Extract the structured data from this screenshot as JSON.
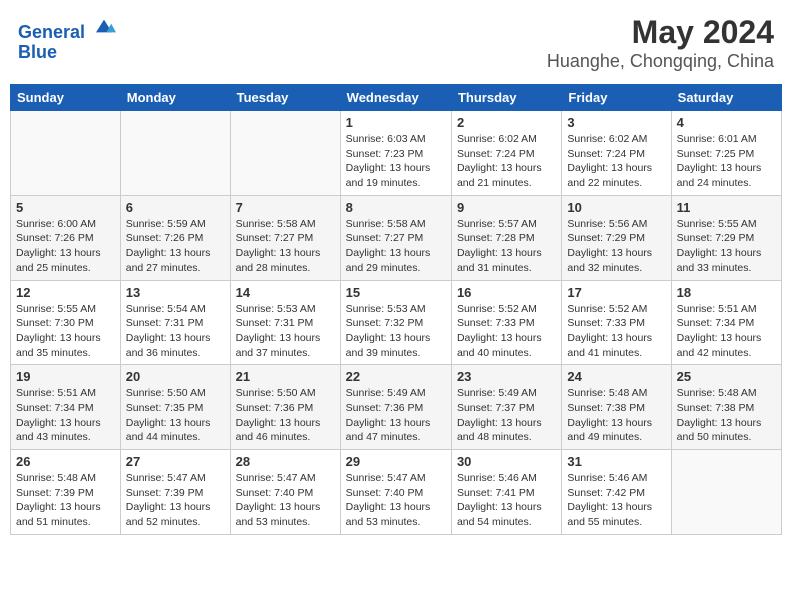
{
  "header": {
    "logo_line1": "General",
    "logo_line2": "Blue",
    "month": "May 2024",
    "location": "Huanghe, Chongqing, China"
  },
  "weekdays": [
    "Sunday",
    "Monday",
    "Tuesday",
    "Wednesday",
    "Thursday",
    "Friday",
    "Saturday"
  ],
  "weeks": [
    [
      {
        "day": "",
        "sunrise": "",
        "sunset": "",
        "daylight": ""
      },
      {
        "day": "",
        "sunrise": "",
        "sunset": "",
        "daylight": ""
      },
      {
        "day": "",
        "sunrise": "",
        "sunset": "",
        "daylight": ""
      },
      {
        "day": "1",
        "sunrise": "Sunrise: 6:03 AM",
        "sunset": "Sunset: 7:23 PM",
        "daylight": "Daylight: 13 hours and 19 minutes."
      },
      {
        "day": "2",
        "sunrise": "Sunrise: 6:02 AM",
        "sunset": "Sunset: 7:24 PM",
        "daylight": "Daylight: 13 hours and 21 minutes."
      },
      {
        "day": "3",
        "sunrise": "Sunrise: 6:02 AM",
        "sunset": "Sunset: 7:24 PM",
        "daylight": "Daylight: 13 hours and 22 minutes."
      },
      {
        "day": "4",
        "sunrise": "Sunrise: 6:01 AM",
        "sunset": "Sunset: 7:25 PM",
        "daylight": "Daylight: 13 hours and 24 minutes."
      }
    ],
    [
      {
        "day": "5",
        "sunrise": "Sunrise: 6:00 AM",
        "sunset": "Sunset: 7:26 PM",
        "daylight": "Daylight: 13 hours and 25 minutes."
      },
      {
        "day": "6",
        "sunrise": "Sunrise: 5:59 AM",
        "sunset": "Sunset: 7:26 PM",
        "daylight": "Daylight: 13 hours and 27 minutes."
      },
      {
        "day": "7",
        "sunrise": "Sunrise: 5:58 AM",
        "sunset": "Sunset: 7:27 PM",
        "daylight": "Daylight: 13 hours and 28 minutes."
      },
      {
        "day": "8",
        "sunrise": "Sunrise: 5:58 AM",
        "sunset": "Sunset: 7:27 PM",
        "daylight": "Daylight: 13 hours and 29 minutes."
      },
      {
        "day": "9",
        "sunrise": "Sunrise: 5:57 AM",
        "sunset": "Sunset: 7:28 PM",
        "daylight": "Daylight: 13 hours and 31 minutes."
      },
      {
        "day": "10",
        "sunrise": "Sunrise: 5:56 AM",
        "sunset": "Sunset: 7:29 PM",
        "daylight": "Daylight: 13 hours and 32 minutes."
      },
      {
        "day": "11",
        "sunrise": "Sunrise: 5:55 AM",
        "sunset": "Sunset: 7:29 PM",
        "daylight": "Daylight: 13 hours and 33 minutes."
      }
    ],
    [
      {
        "day": "12",
        "sunrise": "Sunrise: 5:55 AM",
        "sunset": "Sunset: 7:30 PM",
        "daylight": "Daylight: 13 hours and 35 minutes."
      },
      {
        "day": "13",
        "sunrise": "Sunrise: 5:54 AM",
        "sunset": "Sunset: 7:31 PM",
        "daylight": "Daylight: 13 hours and 36 minutes."
      },
      {
        "day": "14",
        "sunrise": "Sunrise: 5:53 AM",
        "sunset": "Sunset: 7:31 PM",
        "daylight": "Daylight: 13 hours and 37 minutes."
      },
      {
        "day": "15",
        "sunrise": "Sunrise: 5:53 AM",
        "sunset": "Sunset: 7:32 PM",
        "daylight": "Daylight: 13 hours and 39 minutes."
      },
      {
        "day": "16",
        "sunrise": "Sunrise: 5:52 AM",
        "sunset": "Sunset: 7:33 PM",
        "daylight": "Daylight: 13 hours and 40 minutes."
      },
      {
        "day": "17",
        "sunrise": "Sunrise: 5:52 AM",
        "sunset": "Sunset: 7:33 PM",
        "daylight": "Daylight: 13 hours and 41 minutes."
      },
      {
        "day": "18",
        "sunrise": "Sunrise: 5:51 AM",
        "sunset": "Sunset: 7:34 PM",
        "daylight": "Daylight: 13 hours and 42 minutes."
      }
    ],
    [
      {
        "day": "19",
        "sunrise": "Sunrise: 5:51 AM",
        "sunset": "Sunset: 7:34 PM",
        "daylight": "Daylight: 13 hours and 43 minutes."
      },
      {
        "day": "20",
        "sunrise": "Sunrise: 5:50 AM",
        "sunset": "Sunset: 7:35 PM",
        "daylight": "Daylight: 13 hours and 44 minutes."
      },
      {
        "day": "21",
        "sunrise": "Sunrise: 5:50 AM",
        "sunset": "Sunset: 7:36 PM",
        "daylight": "Daylight: 13 hours and 46 minutes."
      },
      {
        "day": "22",
        "sunrise": "Sunrise: 5:49 AM",
        "sunset": "Sunset: 7:36 PM",
        "daylight": "Daylight: 13 hours and 47 minutes."
      },
      {
        "day": "23",
        "sunrise": "Sunrise: 5:49 AM",
        "sunset": "Sunset: 7:37 PM",
        "daylight": "Daylight: 13 hours and 48 minutes."
      },
      {
        "day": "24",
        "sunrise": "Sunrise: 5:48 AM",
        "sunset": "Sunset: 7:38 PM",
        "daylight": "Daylight: 13 hours and 49 minutes."
      },
      {
        "day": "25",
        "sunrise": "Sunrise: 5:48 AM",
        "sunset": "Sunset: 7:38 PM",
        "daylight": "Daylight: 13 hours and 50 minutes."
      }
    ],
    [
      {
        "day": "26",
        "sunrise": "Sunrise: 5:48 AM",
        "sunset": "Sunset: 7:39 PM",
        "daylight": "Daylight: 13 hours and 51 minutes."
      },
      {
        "day": "27",
        "sunrise": "Sunrise: 5:47 AM",
        "sunset": "Sunset: 7:39 PM",
        "daylight": "Daylight: 13 hours and 52 minutes."
      },
      {
        "day": "28",
        "sunrise": "Sunrise: 5:47 AM",
        "sunset": "Sunset: 7:40 PM",
        "daylight": "Daylight: 13 hours and 53 minutes."
      },
      {
        "day": "29",
        "sunrise": "Sunrise: 5:47 AM",
        "sunset": "Sunset: 7:40 PM",
        "daylight": "Daylight: 13 hours and 53 minutes."
      },
      {
        "day": "30",
        "sunrise": "Sunrise: 5:46 AM",
        "sunset": "Sunset: 7:41 PM",
        "daylight": "Daylight: 13 hours and 54 minutes."
      },
      {
        "day": "31",
        "sunrise": "Sunrise: 5:46 AM",
        "sunset": "Sunset: 7:42 PM",
        "daylight": "Daylight: 13 hours and 55 minutes."
      },
      {
        "day": "",
        "sunrise": "",
        "sunset": "",
        "daylight": ""
      }
    ]
  ]
}
